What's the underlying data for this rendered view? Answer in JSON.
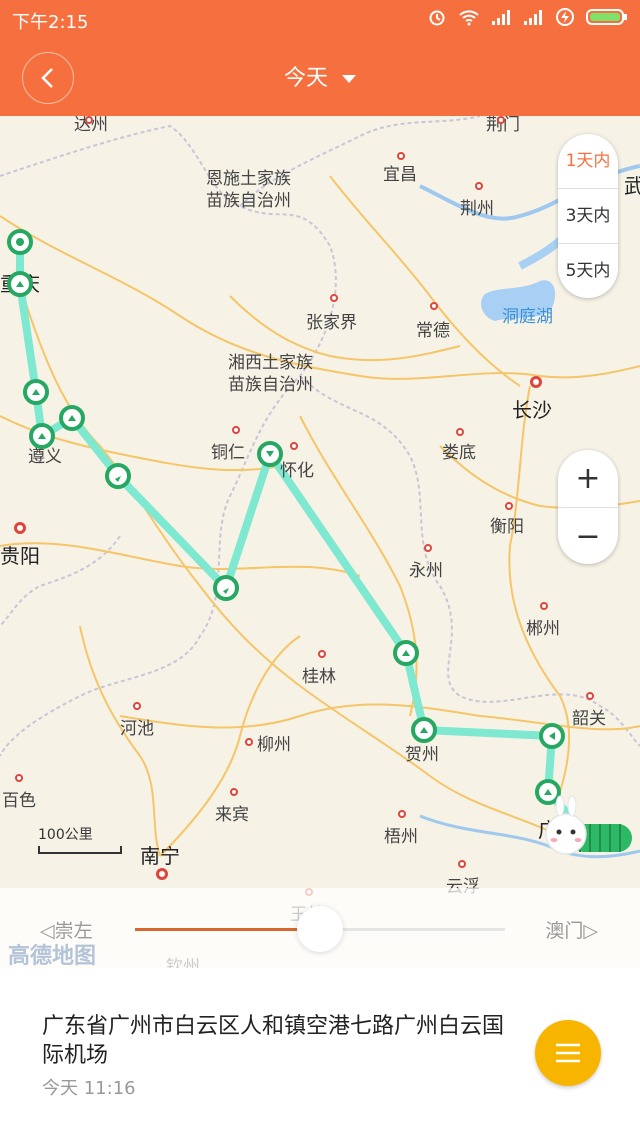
{
  "status_bar": {
    "time": "下午2:15"
  },
  "app_bar": {
    "title": "今天"
  },
  "map": {
    "labels": {
      "dazhou": "达州",
      "jingmen": "荆门",
      "yichang": "宜昌",
      "wu": "武",
      "enshi": "恩施土家族\n苗族自治州",
      "jingzhou": "荆州",
      "chongqing": "重庆",
      "zhangjiajie": "张家界",
      "changde": "常德",
      "dongting": "洞庭湖",
      "xiangxi": "湘西土家族\n苗族自治州",
      "changsha": "长沙",
      "zunyi": "遵义",
      "tongren": "铜仁",
      "huaihua": "怀化",
      "loudi": "娄底",
      "guiyang": "贵阳",
      "hengyang": "衡阳",
      "yongzhou": "永州",
      "chenzhou": "郴州",
      "guilin": "桂林",
      "hechi": "河池",
      "liuzhou": "柳州",
      "shaoguan": "韶关",
      "hezhou": "贺州",
      "baise": "百色",
      "laibin": "来宾",
      "wuzhou": "梧州",
      "nanning": "南宁",
      "yunfu": "云浮",
      "yulin": "玉林",
      "qinzhou": "钦州",
      "guang": "广"
    },
    "range_options": [
      "1天内",
      "3天内",
      "5天内"
    ],
    "range_selected": "1天内",
    "zoom_in": "+",
    "zoom_out": "−",
    "scale_label": "100公里",
    "timeline": {
      "start_label": "崇左",
      "end_label": "澳门",
      "progress": 0.5
    },
    "watermark": "高德地图",
    "route_color": "#7ee8d0",
    "marker_color": "#27a862"
  },
  "location": {
    "address": "广东省广州市白云区人和镇空港七路广州白云国际机场",
    "time": "今天 11:16"
  }
}
